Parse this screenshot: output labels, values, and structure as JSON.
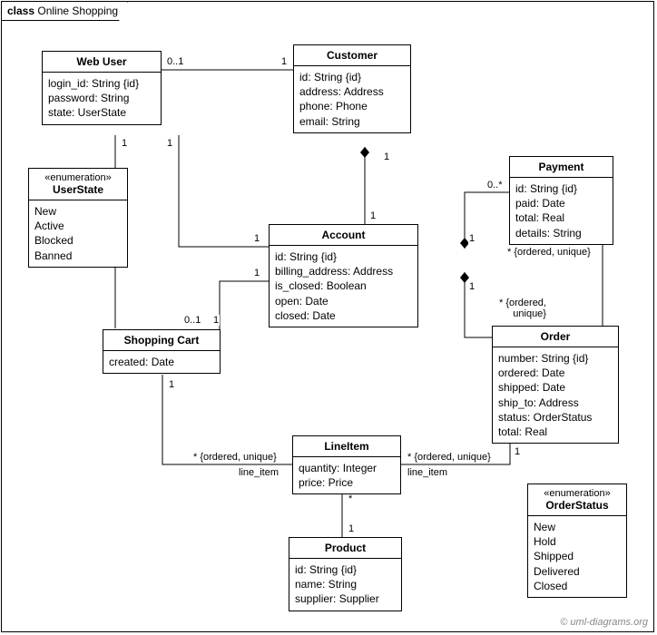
{
  "frame": {
    "label_prefix": "class",
    "label_name": "Online Shopping"
  },
  "classes": {
    "webUser": {
      "name": "Web User",
      "attrs": [
        "login_id: String {id}",
        "password: String",
        "state: UserState"
      ]
    },
    "customer": {
      "name": "Customer",
      "attrs": [
        "id: String {id}",
        "address: Address",
        "phone: Phone",
        "email: String"
      ]
    },
    "payment": {
      "name": "Payment",
      "attrs": [
        "id: String {id}",
        "paid: Date",
        "total: Real",
        "details: String"
      ]
    },
    "userState": {
      "stereotype": "«enumeration»",
      "name": "UserState",
      "literals": [
        "New",
        "Active",
        "Blocked",
        "Banned"
      ]
    },
    "account": {
      "name": "Account",
      "attrs": [
        "id: String {id}",
        "billing_address: Address",
        "is_closed: Boolean",
        "open: Date",
        "closed: Date"
      ]
    },
    "shoppingCart": {
      "name": "Shopping Cart",
      "attrs": [
        "created: Date"
      ]
    },
    "order": {
      "name": "Order",
      "attrs": [
        "number: String {id}",
        "ordered: Date",
        "shipped: Date",
        "ship_to: Address",
        "status: OrderStatus",
        "total: Real"
      ]
    },
    "lineItem": {
      "name": "LineItem",
      "attrs": [
        "quantity: Integer",
        "price: Price"
      ]
    },
    "orderStatus": {
      "stereotype": "«enumeration»",
      "name": "OrderStatus",
      "literals": [
        "New",
        "Hold",
        "Shipped",
        "Delivered",
        "Closed"
      ]
    },
    "product": {
      "name": "Product",
      "attrs": [
        "id: String {id}",
        "name: String",
        "supplier: Supplier"
      ]
    }
  },
  "labels": {
    "m_0_1": "0..1",
    "m_1": "1",
    "m_0_star": "0..*",
    "m_star": "*",
    "ordered_unique": "* {ordered, unique}",
    "ordered_unique_short": "* {ordered,\nunique}",
    "line_item": "line_item"
  },
  "credit": "© uml-diagrams.org"
}
